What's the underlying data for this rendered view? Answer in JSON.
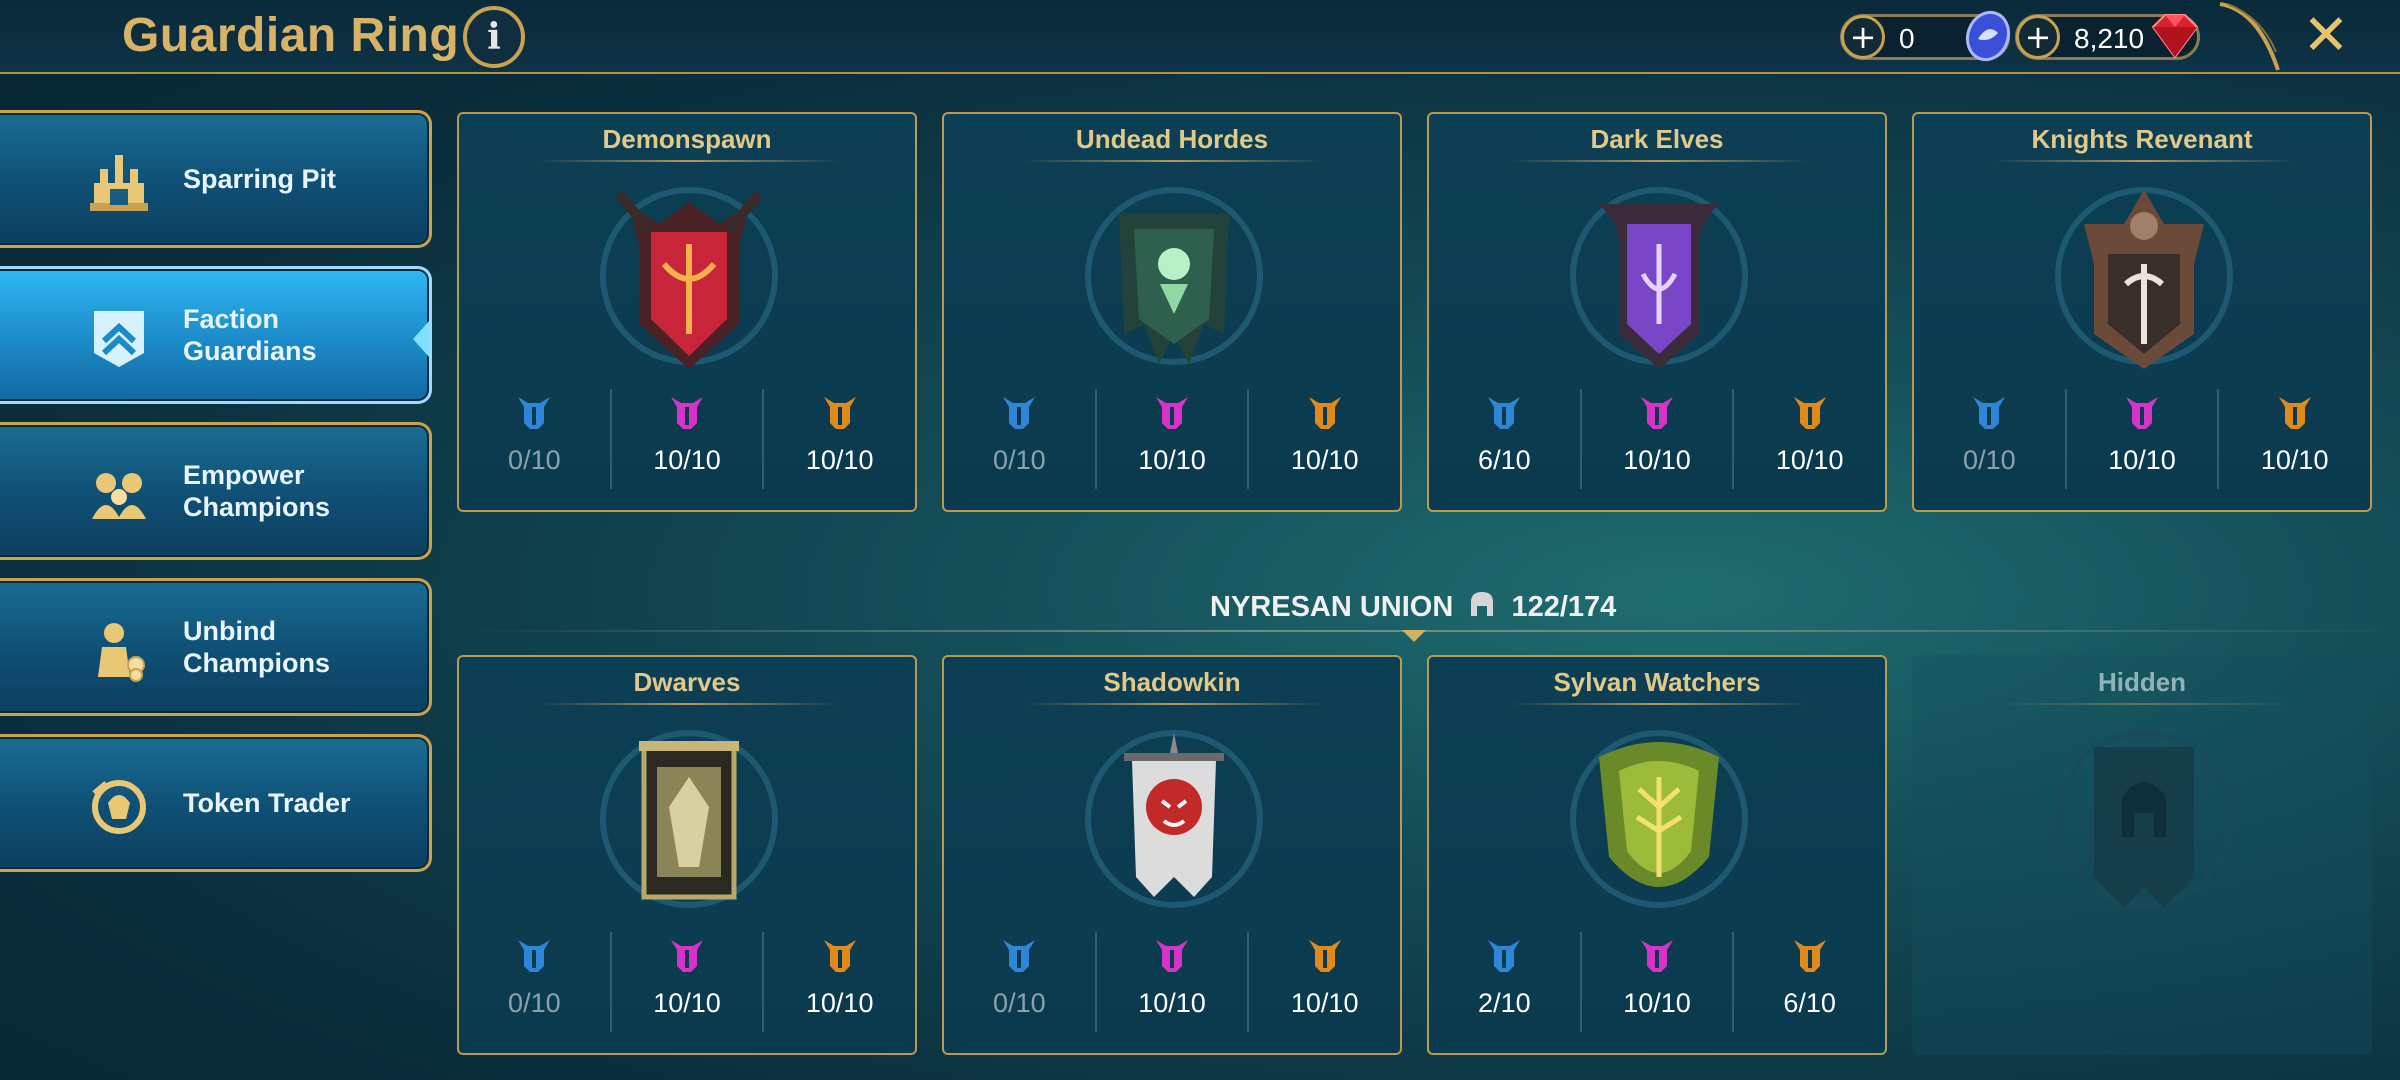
{
  "header": {
    "title": "Guardian Ring",
    "info_label": "i",
    "currency_1": {
      "value": "0",
      "icon": "silver-coin-icon"
    },
    "currency_2": {
      "value": "8,210",
      "icon": "ruby-gem-icon"
    },
    "close_label": "✕"
  },
  "menu": [
    {
      "label": "Sparring Pit",
      "icon": "sparring-pit-icon",
      "active": false
    },
    {
      "label": "Faction\nGuardians",
      "icon": "faction-guardians-icon",
      "active": true
    },
    {
      "label": "Empower\nChampions",
      "icon": "empower-champions-icon",
      "active": false
    },
    {
      "label": "Unbind\nChampions",
      "icon": "unbind-champions-icon",
      "active": false
    },
    {
      "label": "Token Trader",
      "icon": "token-trader-icon",
      "active": false
    }
  ],
  "colors": {
    "rare": "#2f86d6",
    "epic": "#d633c9",
    "legendary": "#e08a1c",
    "gold_border": "#c9a24f"
  },
  "alliance_top": {
    "factions": [
      {
        "name": "Demonspawn",
        "stats": [
          "0/10",
          "10/10",
          "10/10"
        ]
      },
      {
        "name": "Undead Hordes",
        "stats": [
          "0/10",
          "10/10",
          "10/10"
        ]
      },
      {
        "name": "Dark Elves",
        "stats": [
          "6/10",
          "10/10",
          "10/10"
        ]
      },
      {
        "name": "Knights Revenant",
        "stats": [
          "0/10",
          "10/10",
          "10/10"
        ]
      }
    ]
  },
  "union": {
    "name": "NYRESAN UNION",
    "progress": "122/174"
  },
  "alliance_bottom": {
    "factions": [
      {
        "name": "Dwarves",
        "stats": [
          "0/10",
          "10/10",
          "10/10"
        ]
      },
      {
        "name": "Shadowkin",
        "stats": [
          "0/10",
          "10/10",
          "10/10"
        ]
      },
      {
        "name": "Sylvan Watchers",
        "stats": [
          "2/10",
          "10/10",
          "6/10"
        ]
      },
      {
        "name": "Hidden",
        "stats": []
      }
    ]
  }
}
